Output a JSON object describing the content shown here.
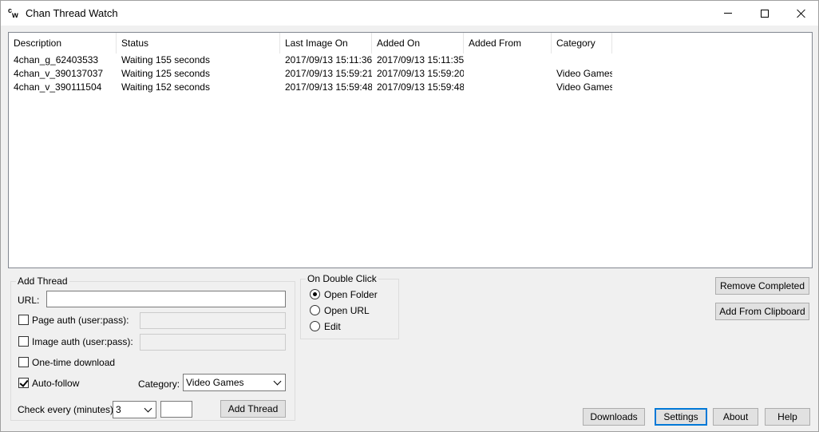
{
  "app": {
    "title": "Chan Thread Watch",
    "icon_c": "c",
    "icon_w": "w"
  },
  "list": {
    "columns": [
      "Description",
      "Status",
      "Last Image On",
      "Added On",
      "Added From",
      "Category"
    ],
    "rows": [
      [
        "4chan_g_62403533",
        "Waiting 155 seconds",
        "2017/09/13 15:11:36",
        "2017/09/13 15:11:35",
        "",
        ""
      ],
      [
        "4chan_v_390137037",
        "Waiting 125 seconds",
        "2017/09/13 15:59:21",
        "2017/09/13 15:59:20",
        "",
        "Video Games"
      ],
      [
        "4chan_v_390111504",
        "Waiting 152 seconds",
        "2017/09/13 15:59:48",
        "2017/09/13 15:59:48",
        "",
        "Video Games"
      ]
    ]
  },
  "add_thread": {
    "title": "Add Thread",
    "url_label": "URL:",
    "url_value": "",
    "page_auth_label": "Page auth (user:pass):",
    "page_auth_checked": false,
    "image_auth_label": "Image auth (user:pass):",
    "image_auth_checked": false,
    "one_time_label": "One-time download",
    "one_time_checked": false,
    "auto_follow_label": "Auto-follow",
    "auto_follow_checked": true,
    "category_label": "Category:",
    "category_value": "Video Games",
    "check_every_label": "Check every (minutes):",
    "check_every_value": "3",
    "extra_value": "",
    "add_button": "Add Thread"
  },
  "double_click": {
    "title": "On Double Click",
    "options": [
      "Open Folder",
      "Open URL",
      "Edit"
    ],
    "selected": "Open Folder"
  },
  "buttons": {
    "remove_completed": "Remove Completed",
    "add_from_clipboard": "Add From Clipboard",
    "downloads": "Downloads",
    "settings": "Settings",
    "about": "About",
    "help": "Help"
  }
}
